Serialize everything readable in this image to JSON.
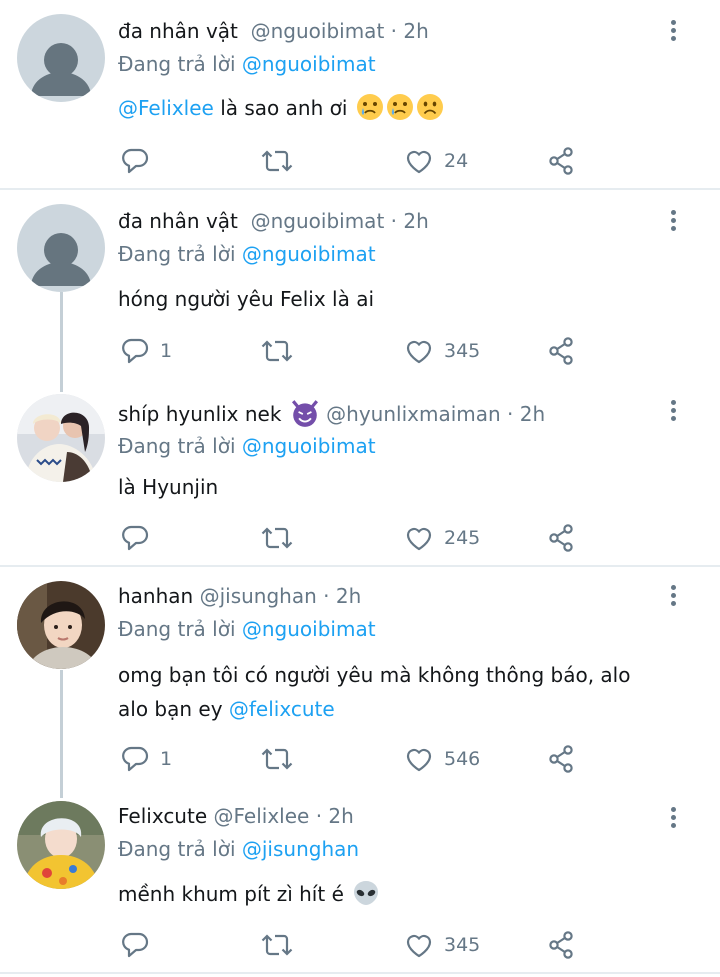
{
  "tweets": [
    {
      "name": "đa nhân vật",
      "handle": "@nguoibimat",
      "time": "· 2h",
      "replying_prefix": "Đang trả lời",
      "replying_to": "@nguoibimat",
      "text_mention": "@Felixlee",
      "text": " là sao anh ơi",
      "text_emojis": [
        "crying-face-emoji",
        "crying-face-emoji",
        "frowning-face-emoji"
      ],
      "reply_count": "",
      "like_count": "24"
    },
    {
      "name": "đa nhân vật",
      "handle": "@nguoibimat",
      "time": "· 2h",
      "replying_prefix": "Đang trả lời",
      "replying_to": "@nguoibimat",
      "text": "hóng người yêu Felix là ai",
      "reply_count": "1",
      "like_count": "345"
    },
    {
      "name": "shíp hyunlix nek",
      "name_emoji": "smiling-devil-emoji",
      "handle": "@hyunlixmaiman",
      "time": "· 2h",
      "replying_prefix": "Đang trả lời",
      "replying_to": "@nguoibimat",
      "text": "là Hyunjin",
      "reply_count": "",
      "like_count": "245"
    },
    {
      "name": "hanhan",
      "handle": "@jisunghan",
      "time": "· 2h",
      "replying_prefix": "Đang trả lời",
      "replying_to": "@nguoibimat",
      "text_line1": "omg bạn tôi có người yêu mà không thông báo,  alo",
      "text_line2": "alo bạn ey ",
      "text_line2_mention": "@felixcute",
      "reply_count": "1",
      "like_count": "546"
    },
    {
      "name": "Felixcute",
      "handle": "@Felixlee",
      "time": "· 2h",
      "replying_prefix": "Đang trả lời",
      "replying_to": "@jisunghan",
      "text": "mềnh khum pít zì hít é",
      "text_emojis": [
        "alien-emoji"
      ],
      "reply_count": "",
      "like_count": "345"
    }
  ],
  "colors": {
    "text": "#14171a",
    "secondary": "#657786",
    "accent": "#1da1f2",
    "thread_line": "#c4cfd6",
    "divider": "#e6ecf0"
  }
}
